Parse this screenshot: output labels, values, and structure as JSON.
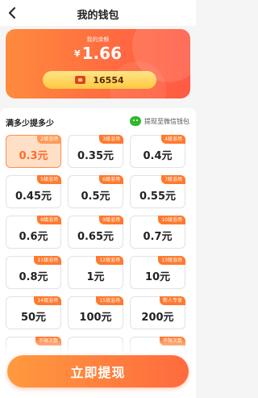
{
  "header": {
    "title": "我的钱包",
    "back_icon": "chevron-left-icon"
  },
  "balance": {
    "label": "我的余额",
    "currency": "¥",
    "amount": "1.66",
    "coins": "16554",
    "coin_icon": "red-envelope-icon"
  },
  "withdraw": {
    "section_title": "满多少提多少",
    "wechat_label": "提现至微信钱包",
    "wechat_icon": "wechat-icon",
    "options": [
      {
        "badge": "2级浴场",
        "amount": "0.3元",
        "selected": true
      },
      {
        "badge": "3级浴场",
        "amount": "0.35元"
      },
      {
        "badge": "4级浴场",
        "amount": "0.4元"
      },
      {
        "badge": "5级浴场",
        "amount": "0.45元"
      },
      {
        "badge": "6级浴场",
        "amount": "0.5元"
      },
      {
        "badge": "7级浴场",
        "amount": "0.55元"
      },
      {
        "badge": "8级浴场",
        "amount": "0.6元"
      },
      {
        "badge": "9级浴场",
        "amount": "0.65元"
      },
      {
        "badge": "10级浴场",
        "amount": "0.7元"
      },
      {
        "badge": "11级浴场",
        "amount": "0.8元"
      },
      {
        "badge": "12级浴场",
        "amount": "1元"
      },
      {
        "badge": "13级浴场",
        "amount": "10元"
      },
      {
        "badge": "14级浴场",
        "amount": "50元"
      },
      {
        "badge": "15级浴场",
        "amount": "100元"
      },
      {
        "badge": "新人专享",
        "amount": "200元"
      },
      {
        "badge": "不限次数",
        "amount": ""
      },
      {
        "badge": "",
        "amount": ""
      },
      {
        "badge": "不限次数",
        "amount": ""
      }
    ]
  },
  "cta": {
    "label": "立即提现"
  },
  "colors": {
    "accent": "#ff6a40",
    "badge": "#ff7a2e",
    "selected_bg": "#ffe0c6",
    "coin_pill": "#ffc93f"
  }
}
